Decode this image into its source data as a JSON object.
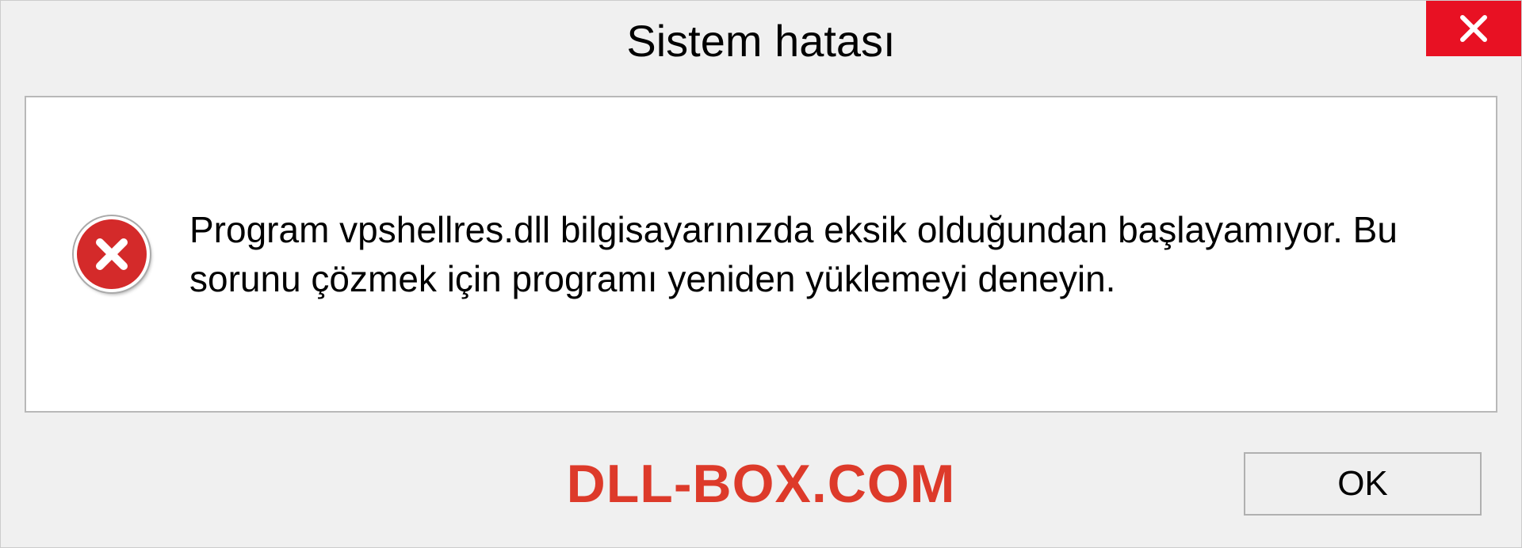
{
  "dialog": {
    "title": "Sistem hatası",
    "message": "Program vpshellres.dll bilgisayarınızda eksik olduğundan başlayamıyor. Bu sorunu çözmek için programı yeniden yüklemeyi deneyin.",
    "ok_label": "OK"
  },
  "watermark": "DLL-BOX.COM",
  "colors": {
    "close_button": "#e81123",
    "error_icon": "#d42a2a",
    "watermark": "#dd3a2a"
  }
}
